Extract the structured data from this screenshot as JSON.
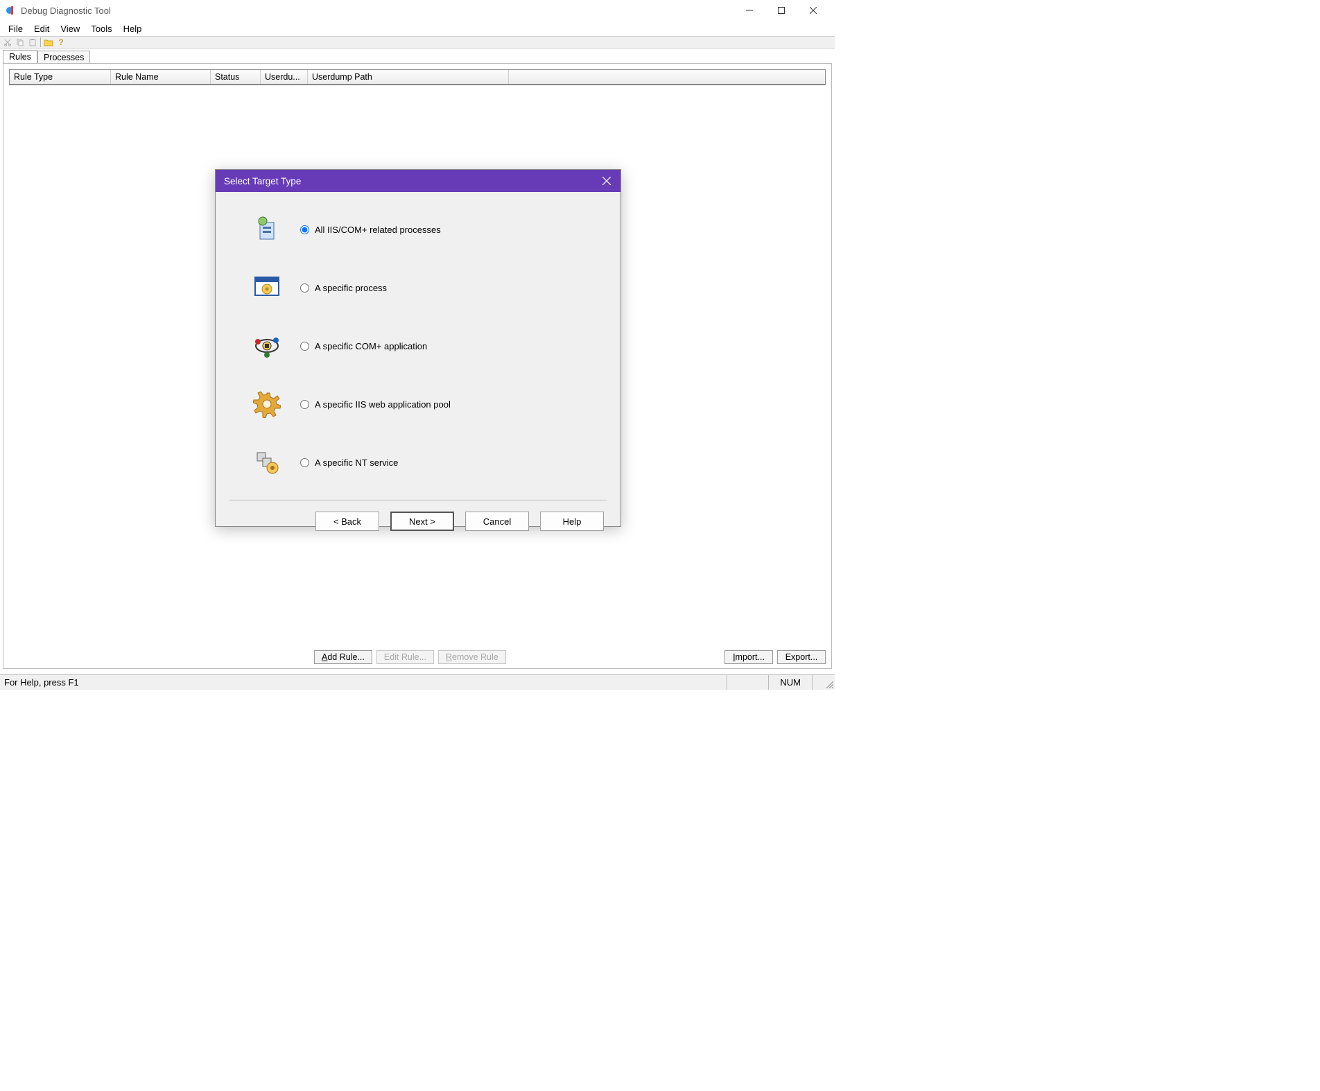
{
  "window": {
    "title": "Debug Diagnostic Tool",
    "controls": {
      "minimize": "—",
      "maximize": "☐",
      "close": "✕"
    }
  },
  "menu": {
    "items": [
      "File",
      "Edit",
      "View",
      "Tools",
      "Help"
    ]
  },
  "tabs": {
    "items": [
      "Rules",
      "Processes"
    ],
    "active": 0
  },
  "table": {
    "columns": [
      "Rule Type",
      "Rule Name",
      "Status",
      "Userdu...",
      "Userdump Path"
    ]
  },
  "buttons": {
    "add_rule": "Add Rule...",
    "edit_rule": "Edit Rule...",
    "remove_rule": "emove Rule",
    "remove_rule_prefix": "R",
    "import": "mport...",
    "import_prefix": "I",
    "export": "Export..."
  },
  "statusbar": {
    "help": "For Help, press F1",
    "num": "NUM"
  },
  "dialog": {
    "title": "Select Target Type",
    "options": [
      "All IIS/COM+ related processes",
      "A specific process",
      "A specific COM+ application",
      "A specific IIS web application pool",
      "A specific NT service"
    ],
    "buttons": {
      "back": "< Back",
      "next": "Next >",
      "cancel": "Cancel",
      "help": "Help"
    }
  }
}
